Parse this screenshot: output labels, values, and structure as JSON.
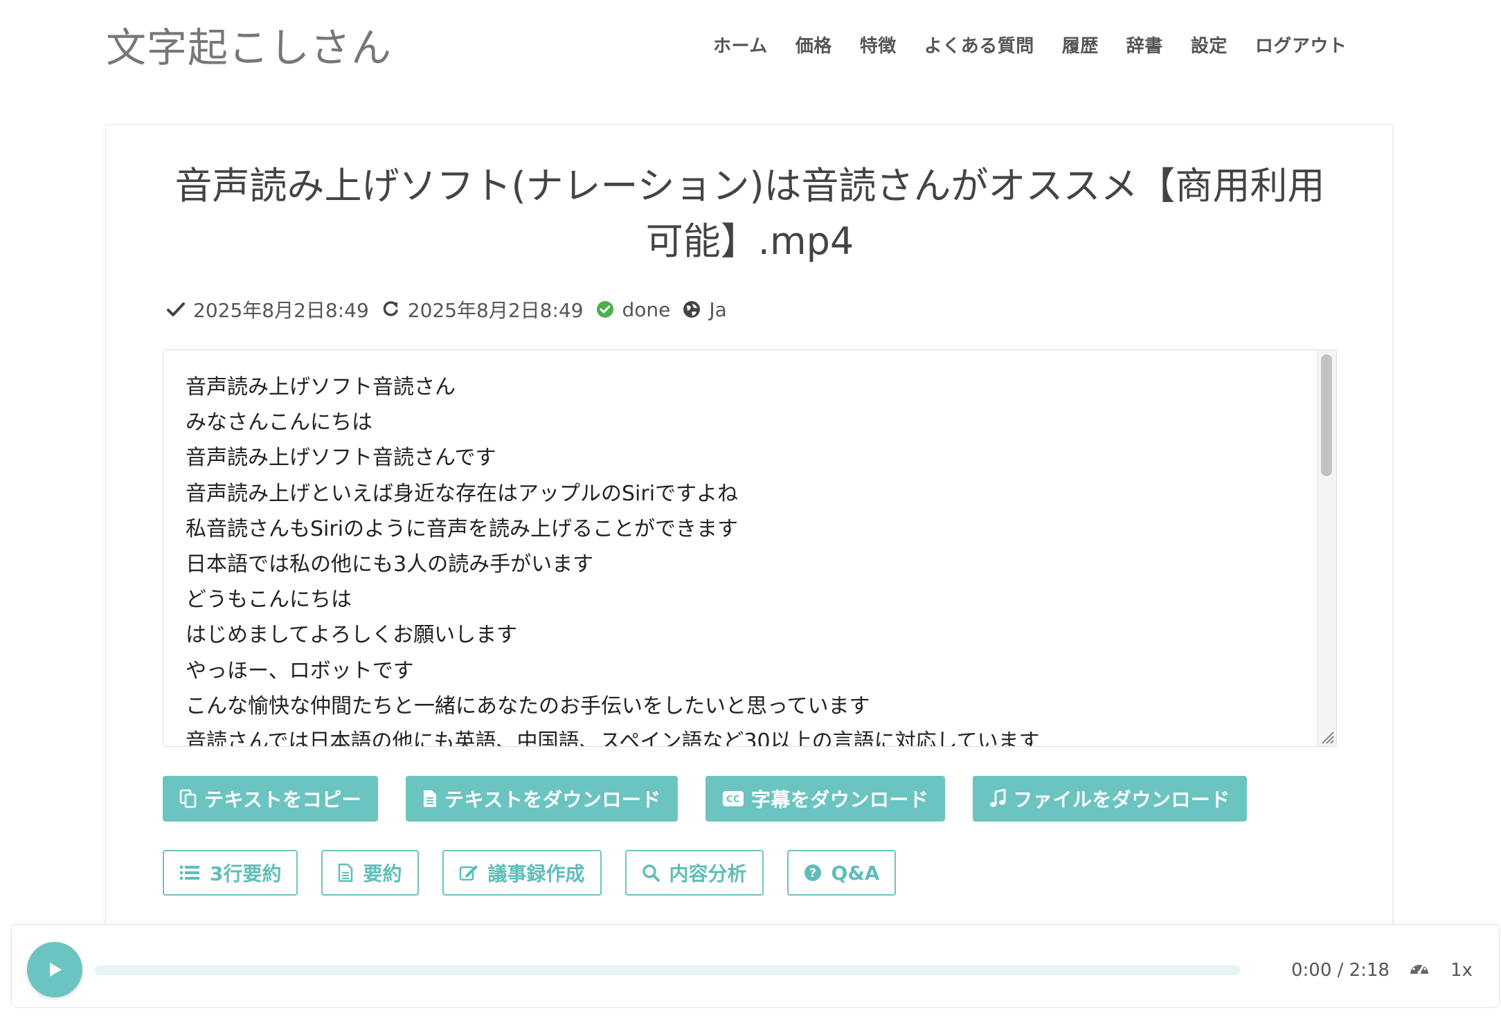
{
  "header": {
    "brand": "文字起こしさん",
    "nav": [
      "ホーム",
      "価格",
      "特徴",
      "よくある質問",
      "履歴",
      "辞書",
      "設定",
      "ログアウト"
    ]
  },
  "file": {
    "title": "音声読み上げソフト(ナレーション)は音読さんがオススメ【商用利用可能】.mp4",
    "created": "2025年8月2日8:49",
    "updated": "2025年8月2日8:49",
    "status": "done",
    "language": "Ja"
  },
  "transcript": {
    "lines": [
      "音声読み上げソフト音読さん",
      "みなさんこんにちは",
      "音声読み上げソフト音読さんです",
      "音声読み上げといえば身近な存在はアップルのSiriですよね",
      "私音読さんもSiriのように音声を読み上げることができます",
      "日本語では私の他にも3人の読み手がいます",
      "どうもこんにちは",
      "はじめましてよろしくお願いします",
      "やっほー、ロボットです",
      "こんな愉快な仲間たちと一緒にあなたのお手伝いをしたいと思っています",
      "音読さんでは日本語の他にも英語、中国語、スペイン語など30以上の言語に対応しています"
    ]
  },
  "actions": {
    "copy_text": "テキストをコピー",
    "download_text": "テキストをダウンロード",
    "download_subtitles": "字幕をダウンロード",
    "download_file": "ファイルをダウンロード",
    "summary_3line": "3行要約",
    "summary": "要約",
    "minutes": "議事録作成",
    "analysis": "内容分析",
    "qa": "Q&A"
  },
  "player": {
    "time": "0:00 / 2:18",
    "speed": "1x",
    "progress": 0
  },
  "colors": {
    "accent": "#6cc4c1",
    "status_ok": "#4caf50"
  }
}
